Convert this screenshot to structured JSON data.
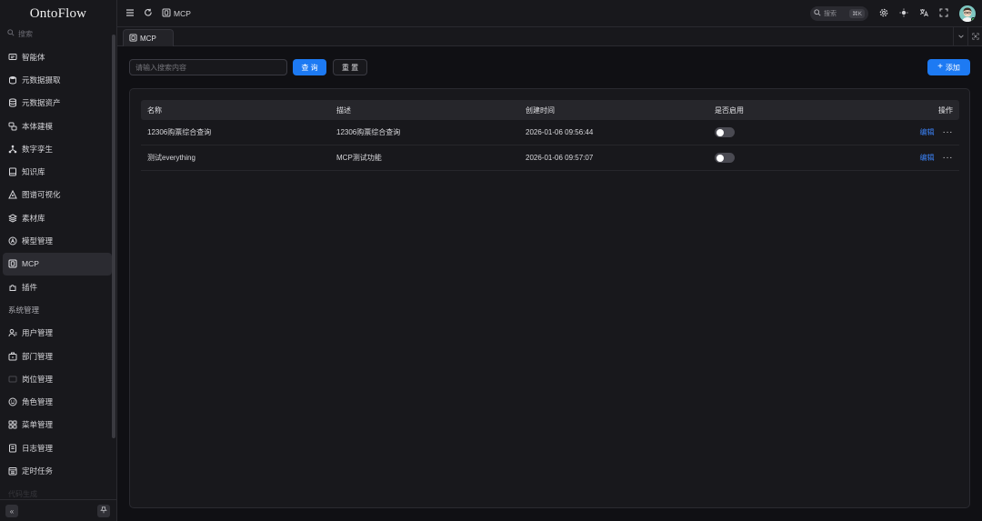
{
  "app": {
    "logo": "OntoFlow"
  },
  "sidebar": {
    "search_placeholder": "搜索",
    "items": [
      {
        "label": "智能体",
        "icon": "chat-box-icon"
      },
      {
        "label": "元数据摄取",
        "icon": "database-import-icon"
      },
      {
        "label": "元数据资产",
        "icon": "database-icon"
      },
      {
        "label": "本体建模",
        "icon": "model-icon"
      },
      {
        "label": "数字孪生",
        "icon": "network-icon"
      },
      {
        "label": "知识库",
        "icon": "book-icon"
      },
      {
        "label": "图谱可视化",
        "icon": "graph-icon"
      },
      {
        "label": "素材库",
        "icon": "layers-icon"
      },
      {
        "label": "模型管理",
        "icon": "circle-a-icon"
      },
      {
        "label": "MCP",
        "icon": "mcp-icon",
        "active": true
      },
      {
        "label": "插件",
        "icon": "plugin-icon"
      }
    ],
    "group_label": "系统管理",
    "system_items": [
      {
        "label": "用户管理",
        "icon": "users-icon"
      },
      {
        "label": "部门管理",
        "icon": "department-icon"
      },
      {
        "label": "岗位管理",
        "icon": "position-icon"
      },
      {
        "label": "角色管理",
        "icon": "role-icon"
      },
      {
        "label": "菜单管理",
        "icon": "menu-grid-icon"
      },
      {
        "label": "日志管理",
        "icon": "log-icon"
      },
      {
        "label": "定时任务",
        "icon": "calendar-icon"
      }
    ],
    "faded_item": "代码生成"
  },
  "topbar": {
    "breadcrumb": "MCP",
    "search_label": "搜索",
    "search_shortcut": "⌘K"
  },
  "tabs": [
    {
      "label": "MCP"
    }
  ],
  "toolbar": {
    "search_placeholder": "请输入搜索内容",
    "query_label": "查 询",
    "reset_label": "重 置",
    "add_label": "添加"
  },
  "table": {
    "headers": [
      "名称",
      "描述",
      "创建时间",
      "是否启用",
      "操作"
    ],
    "rows": [
      {
        "name": "12306购票综合查询",
        "desc": "12306购票综合查询",
        "created": "2026-01-06 09:56:44",
        "enabled": false,
        "action": "编辑"
      },
      {
        "name": "测试everything",
        "desc": "MCP测试功能",
        "created": "2026-01-06 09:57:07",
        "enabled": false,
        "action": "编辑"
      }
    ]
  },
  "colors": {
    "primary": "#1d7af3",
    "link": "#3b82f6",
    "background": "#101014",
    "panel": "#18181c"
  }
}
